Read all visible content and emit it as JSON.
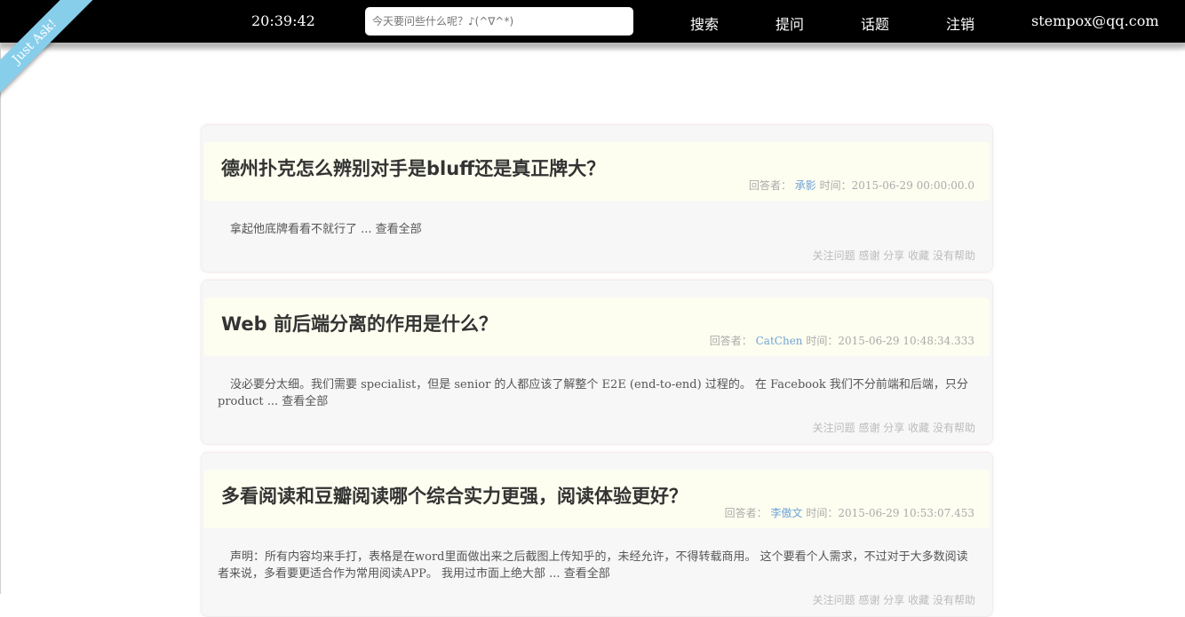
{
  "ribbon": "Just Ask!",
  "header": {
    "clock": "20:39:42",
    "search_placeholder": "今天要问些什么呢？♪(^∇^*)",
    "nav": {
      "search": "搜索",
      "ask": "提问",
      "topics": "话题",
      "logout": "注销",
      "user": "stempox@qq.com"
    }
  },
  "labels": {
    "answerer": "回答者：",
    "time": "时间：",
    "read_all": "查看全部"
  },
  "actions": [
    "关注问题",
    "感谢",
    "分享",
    "收藏",
    "没有帮助"
  ],
  "questions": [
    {
      "title": "德州扑克怎么辨别对手是bluff还是真正牌大？",
      "author": "承影",
      "time": "2015-06-29 00:00:00.0",
      "excerpt": "拿起他底牌看看不就行了 ..."
    },
    {
      "title": "Web 前后端分离的作用是什么？",
      "author": "CatChen",
      "time": "2015-06-29 10:48:34.333",
      "excerpt": "没必要分太细。我们需要 specialist，但是 senior 的人都应该了解整个 E2E (end-to-end) 过程的。 在 Facebook 我们不分前端和后端，只分 product ..."
    },
    {
      "title": "多看阅读和豆瓣阅读哪个综合实力更强，阅读体验更好？",
      "author": "李傲文",
      "time": "2015-06-29 10:53:07.453",
      "excerpt": "声明：所有内容均来手打，表格是在word里面做出来之后截图上传知乎的，未经允许，不得转载商用。 这个要看个人需求，不过对于大多数阅读者来说，多看要更适合作为常用阅读APP。 我用过市面上绝大部 ..."
    }
  ]
}
